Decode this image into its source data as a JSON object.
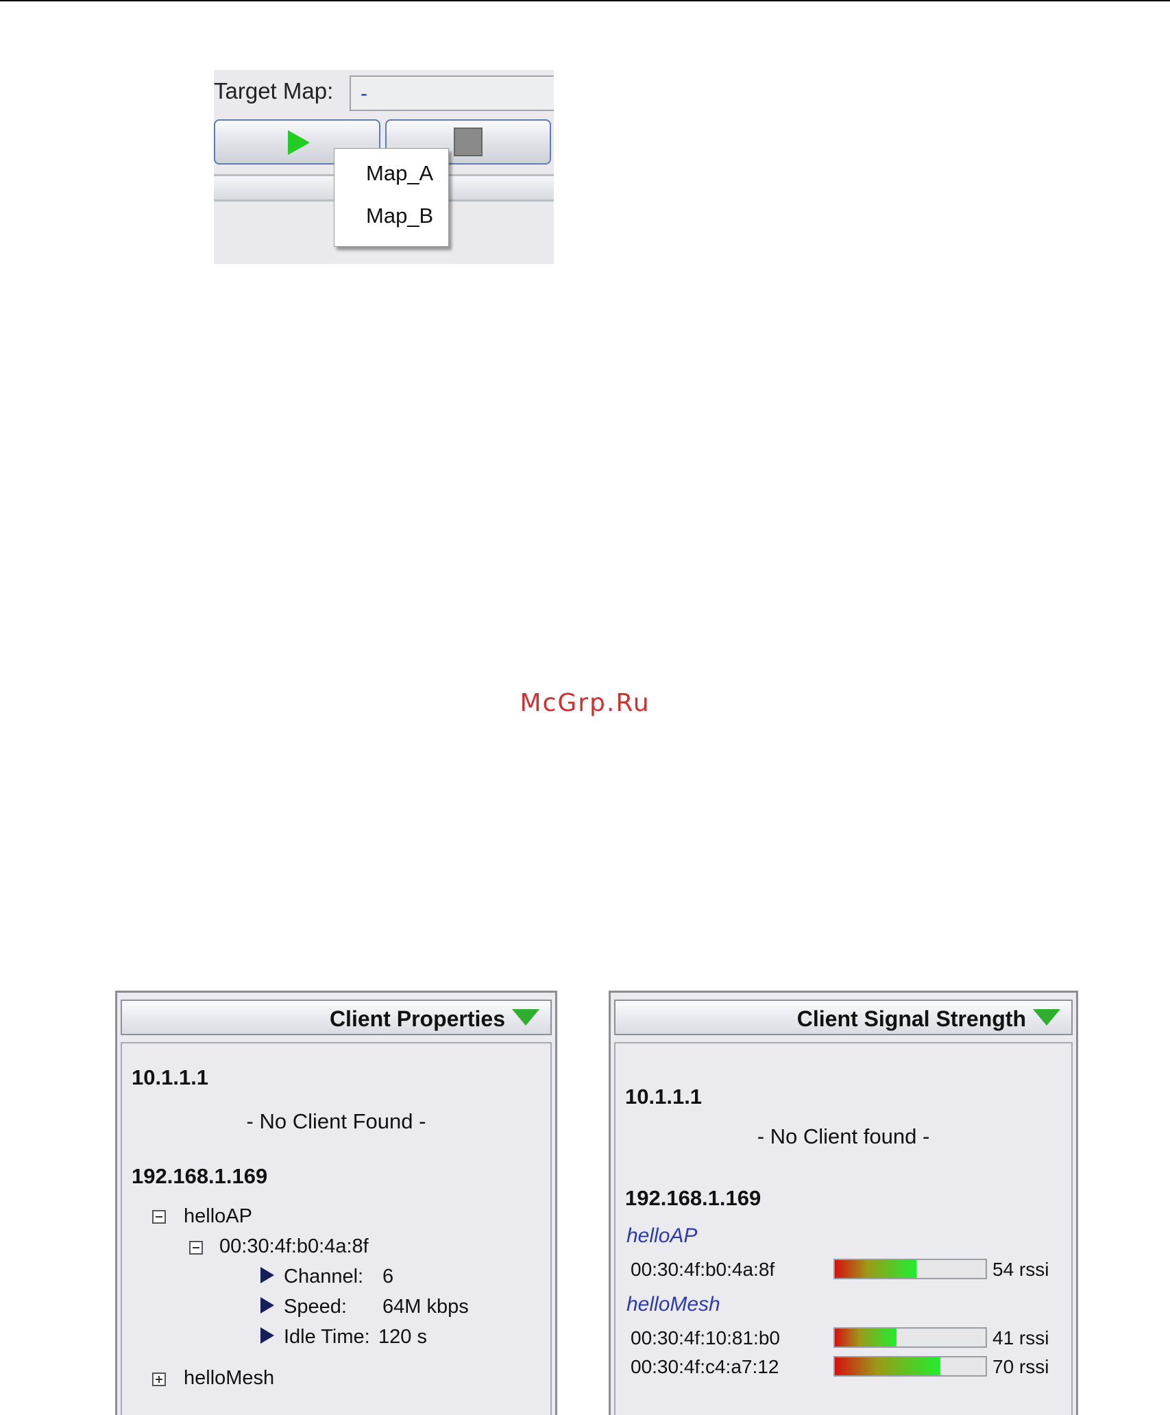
{
  "target_map": {
    "label": "Target Map:",
    "value": "-",
    "menu_items": [
      "Map_A",
      "Map_B"
    ]
  },
  "watermark": "McGrp.Ru",
  "client_properties": {
    "title": "Client Properties",
    "hosts": [
      {
        "ip": "10.1.1.1",
        "message": "- No Client Found -"
      },
      {
        "ip": "192.168.1.169"
      }
    ],
    "tree": {
      "ap_name": "helloAP",
      "mac": "00:30:4f:b0:4a:8f",
      "channel_label": "Channel:",
      "channel_value": "6",
      "speed_label": "Speed:",
      "speed_value": "64M kbps",
      "idle_label": "Idle Time:",
      "idle_value": "120 s",
      "mesh_name": "helloMesh"
    }
  },
  "client_signal": {
    "title": "Client Signal Strength",
    "hosts": [
      {
        "ip": "10.1.1.1",
        "message": "- No Client found -"
      },
      {
        "ip": "192.168.1.169"
      }
    ],
    "groups": [
      {
        "ssid": "helloAP",
        "clients": [
          {
            "mac": "00:30:4f:b0:4a:8f",
            "rssi": 54,
            "rssi_label": "54 rssi"
          }
        ]
      },
      {
        "ssid": "helloMesh",
        "clients": [
          {
            "mac": "00:30:4f:10:81:b0",
            "rssi": 41,
            "rssi_label": "41 rssi"
          },
          {
            "mac": "00:30:4f:c4:a7:12",
            "rssi": 70,
            "rssi_label": "70 rssi"
          }
        ]
      }
    ],
    "colors": {
      "low": "#d61010",
      "high": "#20ee30"
    }
  }
}
